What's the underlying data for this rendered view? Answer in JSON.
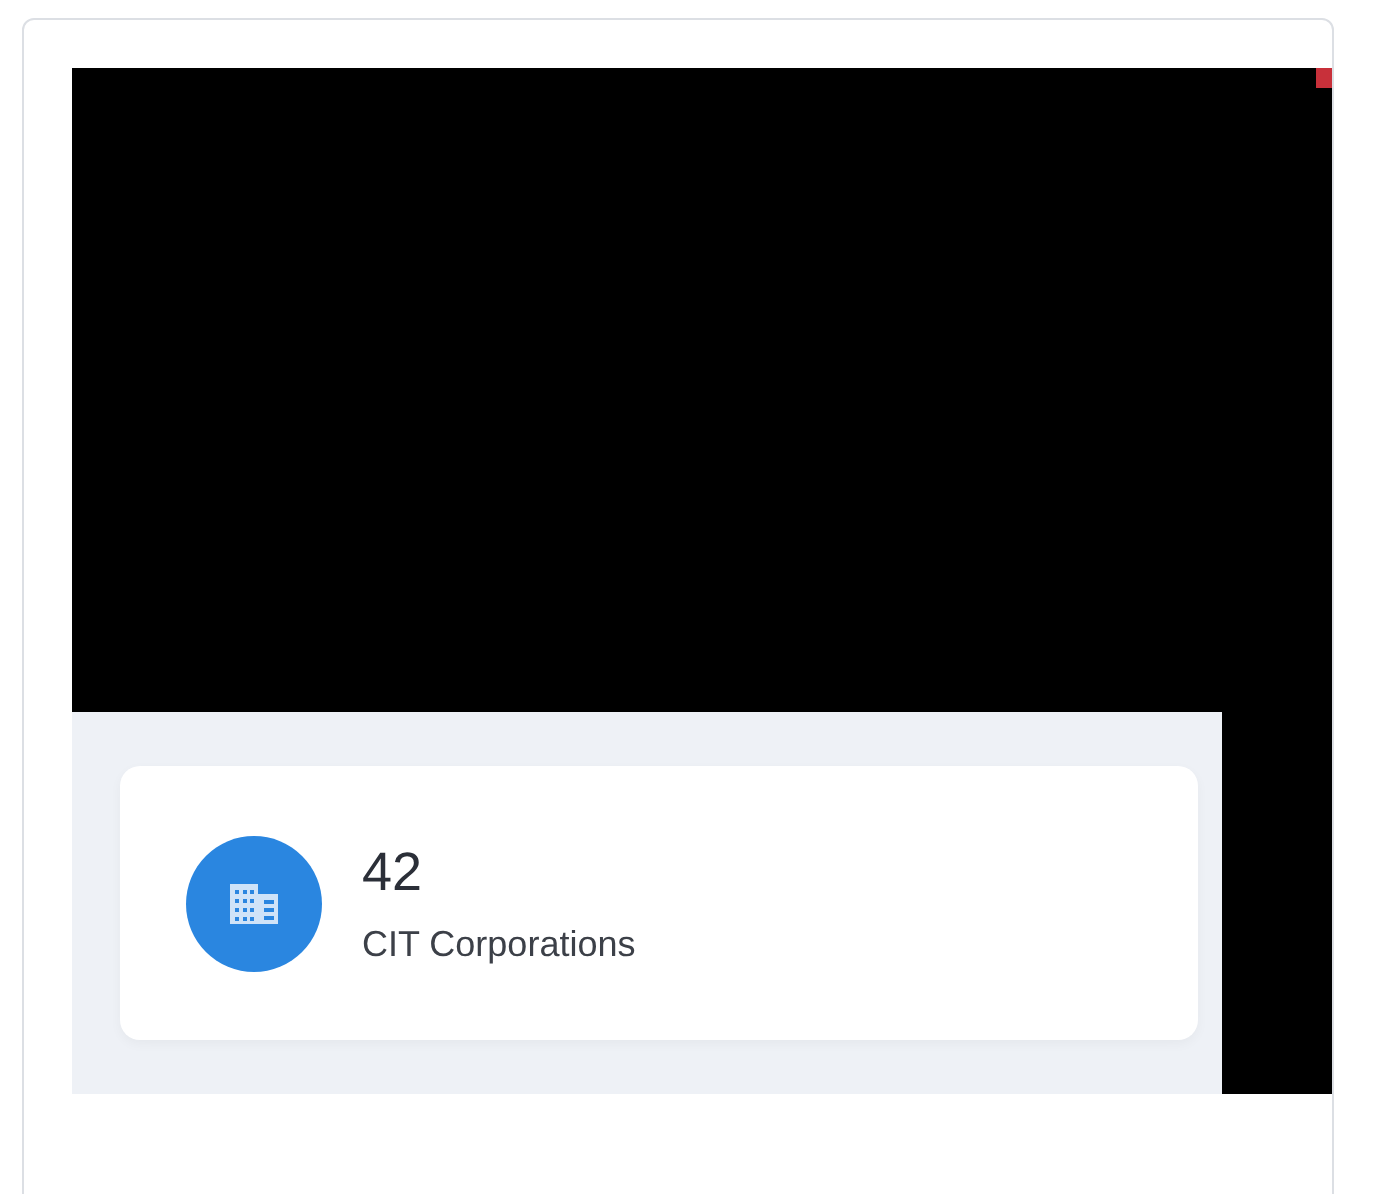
{
  "stat_card": {
    "value": "42",
    "label": "CIT Corporations"
  }
}
